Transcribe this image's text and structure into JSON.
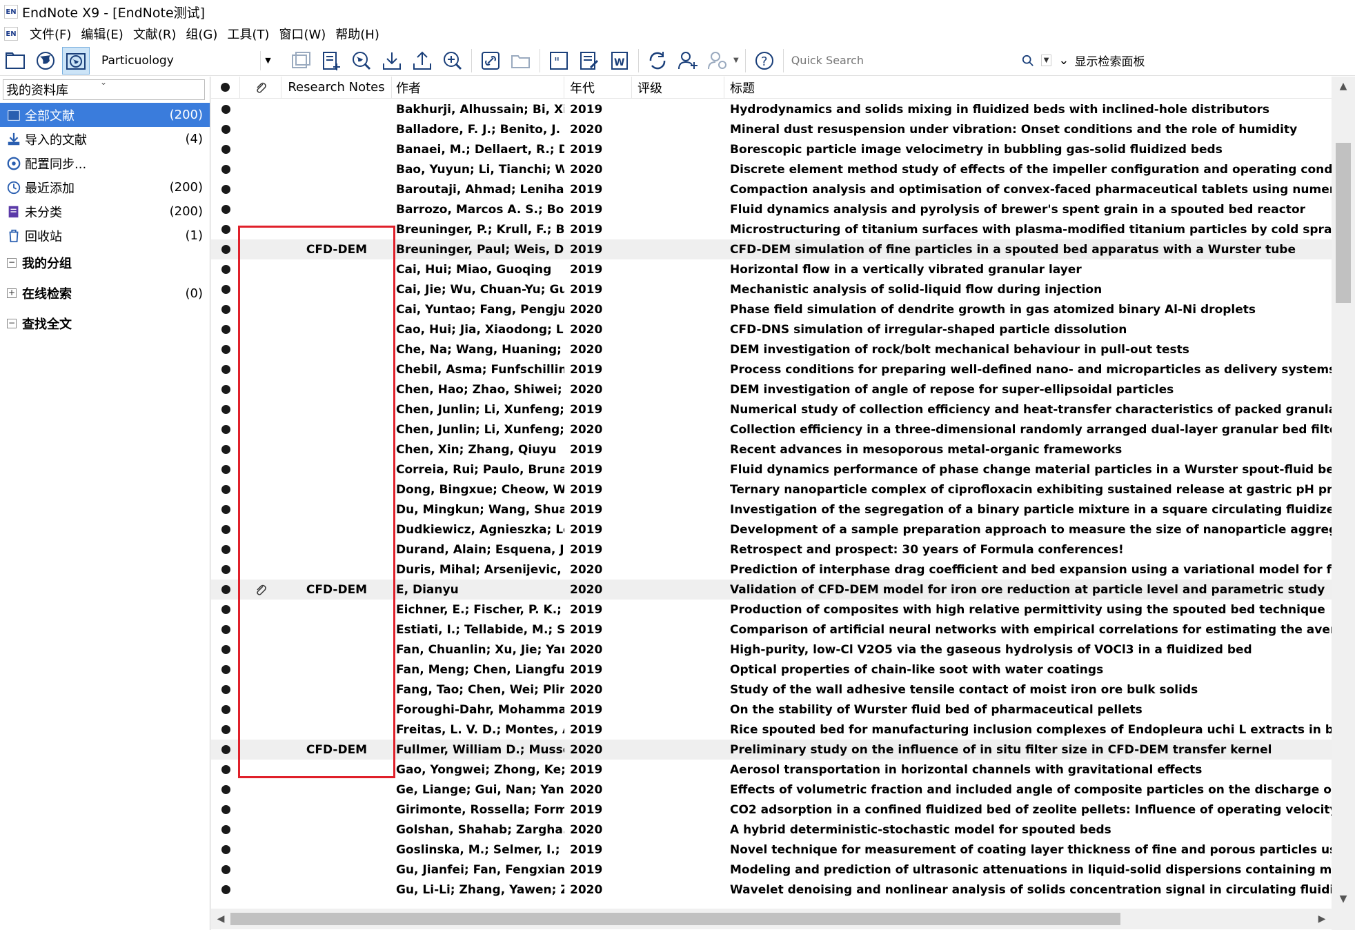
{
  "app": {
    "title": "EndNote X9 - [EndNote测试]",
    "logo_text": "EN"
  },
  "menu": [
    "文件(F)",
    "编辑(E)",
    "文献(R)",
    "组(G)",
    "工具(T)",
    "窗口(W)",
    "帮助(H)"
  ],
  "toolbar": {
    "style_value": "Particuology",
    "quick_search_placeholder": "Quick Search",
    "show_panel_label": "显示检索面板"
  },
  "library": {
    "header": "我的资料库",
    "items": [
      {
        "label": "全部文献",
        "count": "(200)",
        "icon": "all-references-icon"
      },
      {
        "label": "导入的文献",
        "count": "(4)",
        "icon": "import-icon"
      },
      {
        "label": "配置同步...",
        "count": "",
        "icon": "sync-icon"
      },
      {
        "label": "最近添加",
        "count": "(200)",
        "icon": "recent-icon"
      },
      {
        "label": "未分类",
        "count": "(200)",
        "icon": "unfiled-icon"
      },
      {
        "label": "回收站",
        "count": "(1)",
        "icon": "trash-icon"
      }
    ],
    "groups": [
      {
        "label": "我的分组",
        "sign": "⊟",
        "count": ""
      },
      {
        "label": "在线检索",
        "sign": "⊞",
        "count": "(0)"
      },
      {
        "label": "查找全文",
        "sign": "⊟",
        "count": ""
      }
    ]
  },
  "columns": {
    "notes": "Research Notes",
    "author": "作者",
    "year": "年代",
    "rating": "评级",
    "title": "标题"
  },
  "rows": [
    {
      "attach": false,
      "notes": "",
      "author": "Bakhurji, Alhussain; Bi, Xi...",
      "year": "2019",
      "title": "Hydrodynamics and solids mixing in fluidized beds with inclined-hole distributors",
      "shaded": false
    },
    {
      "attach": false,
      "notes": "",
      "author": "Balladore, F. J.; Benito, J. ...",
      "year": "2020",
      "title": "Mineral dust resuspension under vibration: Onset conditions and the role of humidity",
      "shaded": false
    },
    {
      "attach": false,
      "notes": "",
      "author": "Banaei, M.; Dellaert, R.; D...",
      "year": "2019",
      "title": "Borescopic particle image velocimetry in bubbling gas-solid fluidized beds",
      "shaded": false
    },
    {
      "attach": false,
      "notes": "",
      "author": "Bao, Yuyun; Li, Tianchi; W...",
      "year": "2020",
      "title": "Discrete element method study of effects of the impeller configuration and operating conditions on pa",
      "shaded": false
    },
    {
      "attach": false,
      "notes": "",
      "author": "Baroutaji, Ahmad; Leniha...",
      "year": "2019",
      "title": "Compaction analysis and optimisation of convex-faced pharmaceutical tablets using numerical technic",
      "shaded": false
    },
    {
      "attach": false,
      "notes": "",
      "author": "Barrozo, Marcos A. S.; Bor...",
      "year": "2019",
      "title": "Fluid dynamics analysis and pyrolysis of brewer's spent grain in a spouted bed reactor",
      "shaded": false
    },
    {
      "attach": false,
      "notes": "",
      "author": "Breuninger, P.; Krull, F.; Bu...",
      "year": "2019",
      "title": "Microstructuring of titanium surfaces with plasma-modified titanium particles by cold spraying",
      "shaded": false
    },
    {
      "attach": false,
      "notes": "CFD-DEM",
      "author": "Breuninger, Paul; Weis, D...",
      "year": "2019",
      "title": "CFD-DEM simulation of fine particles in a spouted bed apparatus with a Wurster tube",
      "shaded": true
    },
    {
      "attach": false,
      "notes": "",
      "author": "Cai, Hui; Miao, Guoqing",
      "year": "2019",
      "title": "Horizontal flow in a vertically vibrated granular layer",
      "shaded": false
    },
    {
      "attach": false,
      "notes": "",
      "author": "Cai, Jie; Wu, Chuan-Yu; Gu...",
      "year": "2019",
      "title": "Mechanistic analysis of solid-liquid flow during injection",
      "shaded": false
    },
    {
      "attach": false,
      "notes": "",
      "author": "Cai, Yuntao; Fang, Pengjun...",
      "year": "2020",
      "title": "Phase field simulation of dendrite growth in gas atomized binary Al-Ni droplets",
      "shaded": false
    },
    {
      "attach": false,
      "notes": "",
      "author": "Cao, Hui; Jia, Xiaodong; Li...",
      "year": "2020",
      "title": "CFD-DNS simulation of irregular-shaped particle dissolution",
      "shaded": false
    },
    {
      "attach": false,
      "notes": "",
      "author": "Che, Na; Wang, Huaning; ...",
      "year": "2020",
      "title": "DEM investigation of rock/bolt mechanical behaviour in pull-out tests",
      "shaded": false
    },
    {
      "attach": false,
      "notes": "",
      "author": "Chebil, Asma; Funfschillin...",
      "year": "2019",
      "title": "Process conditions for preparing well-defined nano- and microparticles as delivery systems of alkyl ga",
      "shaded": false
    },
    {
      "attach": false,
      "notes": "",
      "author": "Chen, Hao; Zhao, Shiwei; ...",
      "year": "2020",
      "title": "DEM investigation of angle of repose for super-ellipsoidal particles",
      "shaded": false
    },
    {
      "attach": false,
      "notes": "",
      "author": "Chen, Junlin; Li, Xunfeng; ...",
      "year": "2019",
      "title": "Numerical study of collection efficiency and heat-transfer characteristics of packed granular filter",
      "shaded": false
    },
    {
      "attach": false,
      "notes": "",
      "author": "Chen, Junlin; Li, Xunfeng; ...",
      "year": "2020",
      "title": "Collection efficiency in a three-dimensional randomly arranged dual-layer granular bed filter",
      "shaded": false
    },
    {
      "attach": false,
      "notes": "",
      "author": "Chen, Xin; Zhang, Qiuyu",
      "year": "2019",
      "title": "Recent advances in mesoporous metal-organic frameworks",
      "shaded": false
    },
    {
      "attach": false,
      "notes": "",
      "author": "Correia, Rui; Paulo, Bruna ...",
      "year": "2019",
      "title": "Fluid dynamics performance of phase change material particles in a Wurster spout-fluid bed",
      "shaded": false
    },
    {
      "attach": false,
      "notes": "",
      "author": "Dong, Bingxue; Cheow, W...",
      "year": "2019",
      "title": "Ternary nanoparticle complex of ciprofloxacin exhibiting sustained release at gastric pH prepared by c",
      "shaded": false
    },
    {
      "attach": false,
      "notes": "",
      "author": "Du, Mingkun; Wang, Shuai",
      "year": "2019",
      "title": "Investigation of the segregation of a binary particle mixture in a square circulating fluidized bed with",
      "shaded": false
    },
    {
      "attach": false,
      "notes": "",
      "author": "Dudkiewicz, Agnieszka; Le...",
      "year": "2019",
      "title": "Development of a sample preparation approach to measure the size of nanoparticle aggregates by ele",
      "shaded": false
    },
    {
      "attach": false,
      "notes": "",
      "author": "Durand, Alain; Esquena, J....",
      "year": "2019",
      "title": "Retrospect and prospect: 30 years of Formula conferences!",
      "shaded": false
    },
    {
      "attach": false,
      "notes": "",
      "author": "Duris, Mihal; Arsenijevic, ...",
      "year": "2020",
      "title": "Prediction of interphase drag coefficient and bed expansion using a variational model for fluidization",
      "shaded": false
    },
    {
      "attach": true,
      "notes": "CFD-DEM",
      "author": "E, Dianyu",
      "year": "2020",
      "title": "Validation of CFD-DEM model for iron ore reduction at particle level and parametric study",
      "shaded": true
    },
    {
      "attach": false,
      "notes": "",
      "author": "Eichner, E.; Fischer, P. K.; H...",
      "year": "2019",
      "title": "Production of composites with high relative permittivity using the spouted bed technique",
      "shaded": false
    },
    {
      "attach": false,
      "notes": "",
      "author": "Estiati, I.; Tellabide, M.; Sa...",
      "year": "2019",
      "title": "Comparison of artificial neural networks with empirical correlations for estimating the average cycle ti",
      "shaded": false
    },
    {
      "attach": false,
      "notes": "",
      "author": "Fan, Chuanlin; Xu, Jie; Yan...",
      "year": "2020",
      "title": "High-purity, low-Cl V2O5 via the gaseous hydrolysis of VOCl3 in a fluidized bed",
      "shaded": false
    },
    {
      "attach": false,
      "notes": "",
      "author": "Fan, Meng; Chen, Liangfu; ...",
      "year": "2019",
      "title": "Optical properties of chain-like soot with water coatings",
      "shaded": false
    },
    {
      "attach": false,
      "notes": "",
      "author": "Fang, Tao; Chen, Wei; Plin...",
      "year": "2020",
      "title": "Study of the wall adhesive tensile contact of moist iron ore bulk solids",
      "shaded": false
    },
    {
      "attach": false,
      "notes": "",
      "author": "Foroughi-Dahr, Mohamma...",
      "year": "2019",
      "title": "On the stability of Wurster fluid bed of pharmaceutical pellets",
      "shaded": false
    },
    {
      "attach": false,
      "notes": "",
      "author": "Freitas, L. V. D.; Montes, A....",
      "year": "2019",
      "title": "Rice spouted bed for manufacturing inclusion complexes of Endopleura uchi L extracts in beta-cyclode",
      "shaded": false
    },
    {
      "attach": false,
      "notes": "CFD-DEM",
      "author": "Fullmer, William D.; Musse...",
      "year": "2020",
      "title": "Preliminary study on the influence of in situ filter size in CFD-DEM transfer kernel",
      "shaded": true
    },
    {
      "attach": false,
      "notes": "",
      "author": "Gao, Yongwei; Zhong, Ke; ...",
      "year": "2019",
      "title": "Aerosol transportation in horizontal channels with gravitational effects",
      "shaded": false
    },
    {
      "attach": false,
      "notes": "",
      "author": "Ge, Liange; Gui, Nan; Yang...",
      "year": "2020",
      "title": "Effects of volumetric fraction and included angle of composite particles on the discharge of binary mi:",
      "shaded": false
    },
    {
      "attach": false,
      "notes": "",
      "author": "Girimonte, Rossella; Formi...",
      "year": "2019",
      "title": "CO2 adsorption in a confined fluidized bed of zeolite pellets: Influence of operating velocity",
      "shaded": false
    },
    {
      "attach": false,
      "notes": "",
      "author": "Golshan, Shahab; Zargha...",
      "year": "2020",
      "title": "A hybrid deterministic-stochastic model for spouted beds",
      "shaded": false
    },
    {
      "attach": false,
      "notes": "",
      "author": "Goslinska, M.; Selmer, I.; K...",
      "year": "2019",
      "title": "Novel technique for measurement of coating layer thickness of fine and porous particles using focused",
      "shaded": false
    },
    {
      "attach": false,
      "notes": "",
      "author": "Gu, Jianfei; Fan, Fengxian;...",
      "year": "2019",
      "title": "Modeling and prediction of ultrasonic attenuations in liquid-solid dispersions containing mixed particl",
      "shaded": false
    },
    {
      "attach": false,
      "notes": "",
      "author": "Gu, Li-Li; Zhang, Yawen; Z...",
      "year": "2020",
      "title": "Wavelet denoising and nonlinear analysis of solids concentration signal in circulating fluidized bed rise",
      "shaded": false
    }
  ]
}
